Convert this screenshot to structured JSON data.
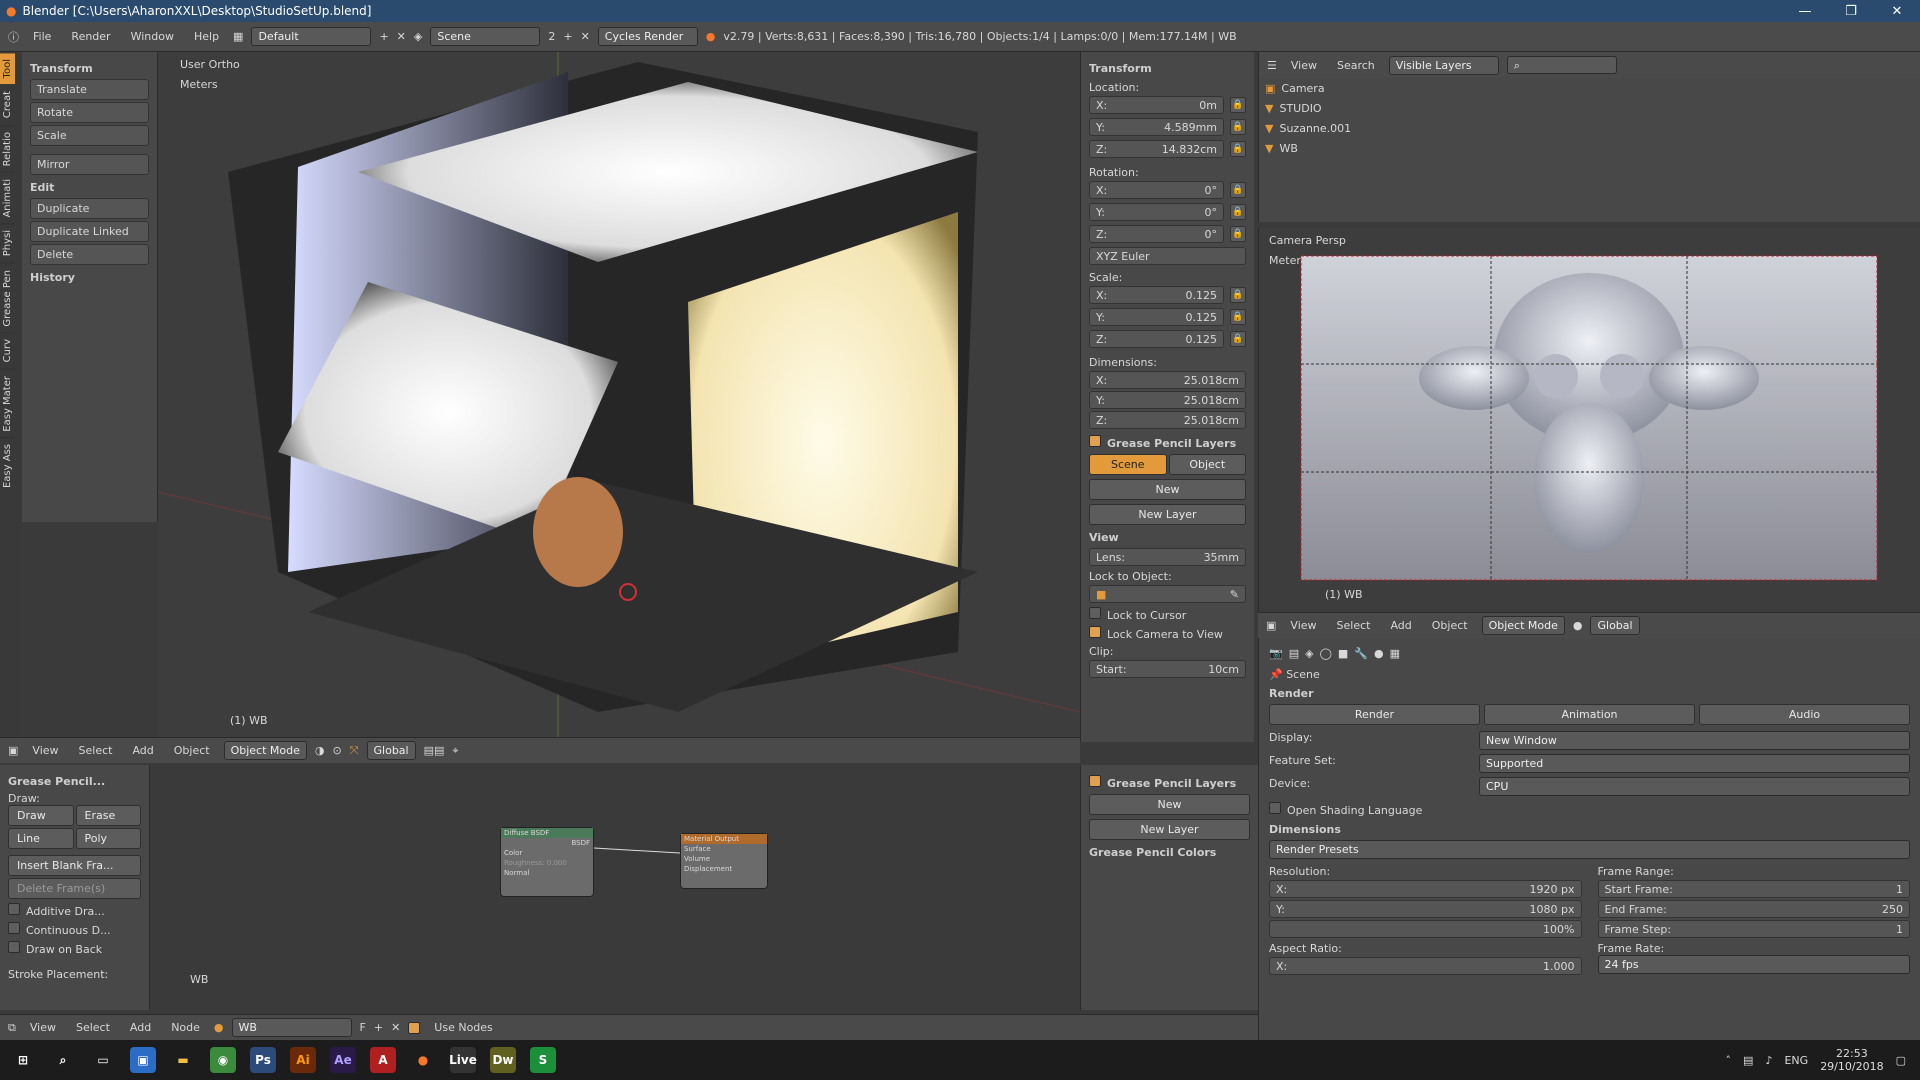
{
  "window": {
    "title": "Blender [C:\\Users\\AharonXXL\\Desktop\\StudioSetUp.blend]",
    "controls": [
      "—",
      "❐",
      "✕"
    ]
  },
  "topbar": {
    "menus": [
      "File",
      "Render",
      "Window",
      "Help"
    ],
    "layout": "Default",
    "scene": "Scene",
    "scene_count": "2",
    "engine": "Cycles Render",
    "stats": "v2.79 | Verts:8,631 | Faces:8,390 | Tris:16,780 | Objects:1/4 | Lamps:0/0 | Mem:177.14M | WB"
  },
  "left_tabs": [
    "Tool",
    "Creat",
    "Relatio",
    "Animati",
    "Physi",
    "Grease Pen",
    "Curv",
    "Easy Mater",
    "Easy Ass"
  ],
  "tool_shelf": {
    "transform_title": "Transform",
    "transform_items": [
      "Translate",
      "Rotate",
      "Scale",
      "Mirror"
    ],
    "edit_title": "Edit",
    "edit_items": [
      "Duplicate",
      "Duplicate Linked",
      "Delete"
    ],
    "history_title": "History"
  },
  "viewport": {
    "label": "User Ortho",
    "units": "Meters",
    "object_label": "(1) WB"
  },
  "viewport_header": {
    "menus": [
      "View",
      "Select",
      "Add",
      "Object"
    ],
    "mode": "Object Mode",
    "orientation": "Global"
  },
  "properties_n": {
    "transform_title": "Transform",
    "location_label": "Location:",
    "location": [
      {
        "axis": "X:",
        "value": "0m"
      },
      {
        "axis": "Y:",
        "value": "4.589mm"
      },
      {
        "axis": "Z:",
        "value": "14.832cm"
      }
    ],
    "rotation_label": "Rotation:",
    "rotation": [
      {
        "axis": "X:",
        "value": "0°"
      },
      {
        "axis": "Y:",
        "value": "0°"
      },
      {
        "axis": "Z:",
        "value": "0°"
      }
    ],
    "rotation_mode": "XYZ Euler",
    "scale_label": "Scale:",
    "scale": [
      {
        "axis": "X:",
        "value": "0.125"
      },
      {
        "axis": "Y:",
        "value": "0.125"
      },
      {
        "axis": "Z:",
        "value": "0.125"
      }
    ],
    "dimensions_label": "Dimensions:",
    "dimensions": [
      {
        "axis": "X:",
        "value": "25.018cm"
      },
      {
        "axis": "Y:",
        "value": "25.018cm"
      },
      {
        "axis": "Z:",
        "value": "25.018cm"
      }
    ],
    "gp_layers_title": "Grease Pencil Layers",
    "gp_tab_scene": "Scene",
    "gp_tab_object": "Object",
    "gp_new": "New",
    "gp_new_layer": "New Layer",
    "view_title": "View",
    "lens_label": "Lens:",
    "lens_value": "35mm",
    "lock_to_object": "Lock to Object:",
    "lock_to_cursor": "Lock to Cursor",
    "lock_camera": "Lock Camera to View",
    "clip_label": "Clip:",
    "clip_start_label": "Start:",
    "clip_start_value": "10cm"
  },
  "outliner": {
    "header": [
      "View",
      "Search"
    ],
    "filter": "Visible Layers",
    "items": [
      "Camera",
      "STUDIO",
      "Suzanne.001",
      "WB"
    ]
  },
  "camera_view": {
    "label": "Camera Persp",
    "units": "Meters",
    "object_label": "(1) WB"
  },
  "camera_header": {
    "menus": [
      "View",
      "Select",
      "Add",
      "Object"
    ],
    "mode": "Object Mode",
    "orientation": "Global"
  },
  "render_props": {
    "scene_label": "Scene",
    "render_title": "Render",
    "buttons": [
      "Render",
      "Animation",
      "Audio"
    ],
    "display_label": "Display:",
    "display_value": "New Window",
    "feature_label": "Feature Set:",
    "feature_value": "Supported",
    "device_label": "Device:",
    "device_value": "CPU",
    "osl": "Open Shading Language",
    "dimensions_title": "Dimensions",
    "render_presets": "Render Presets",
    "resolution_label": "Resolution:",
    "res_x": "1920 px",
    "res_y": "1080 px",
    "res_pct": "100%",
    "aspect_label": "Aspect Ratio:",
    "aspect_x": "1.000",
    "frame_range_label": "Frame Range:",
    "start_frame_label": "Start Frame:",
    "start_frame": "1",
    "end_frame_label": "End Frame:",
    "end_frame": "250",
    "frame_step_label": "Frame Step:",
    "frame_step": "1",
    "frame_rate_label": "Frame Rate:",
    "frame_rate": "24 fps"
  },
  "node_tools": {
    "title": "Grease Pencil...",
    "draw_label": "Draw:",
    "draw": "Draw",
    "erase": "Erase",
    "line": "Line",
    "poly": "Poly",
    "insert_blank": "Insert Blank Fra...",
    "delete_frames": "Delete Frame(s)",
    "additive": "Additive Dra...",
    "continuous": "Continuous D...",
    "draw_on_back": "Draw on Back",
    "stroke_placement": "Stroke Placement:"
  },
  "node_editor": {
    "material_label": "WB",
    "diffuse_title": "Diffuse BSDF",
    "diffuse_out": "BSDF",
    "diffuse_color": "Color",
    "diffuse_rough": "Roughness: 0.000",
    "diffuse_normal": "Normal",
    "output_title": "Material Output",
    "output_surface": "Surface",
    "output_volume": "Volume",
    "output_disp": "Displacement"
  },
  "node_side": {
    "gp_layers_title": "Grease Pencil Layers",
    "new": "New",
    "new_layer": "New Layer",
    "gp_colors": "Grease Pencil Colors"
  },
  "node_header": {
    "menus": [
      "View",
      "Select",
      "Add",
      "Node"
    ],
    "material": "WB",
    "f_label": "F",
    "use_nodes": "Use Nodes"
  },
  "taskbar": {
    "lang": "ENG",
    "time": "22:53",
    "date": "29/10/2018"
  },
  "colors": {
    "accent": "#e39a3b",
    "blender_blue": "#2a4b6e"
  }
}
